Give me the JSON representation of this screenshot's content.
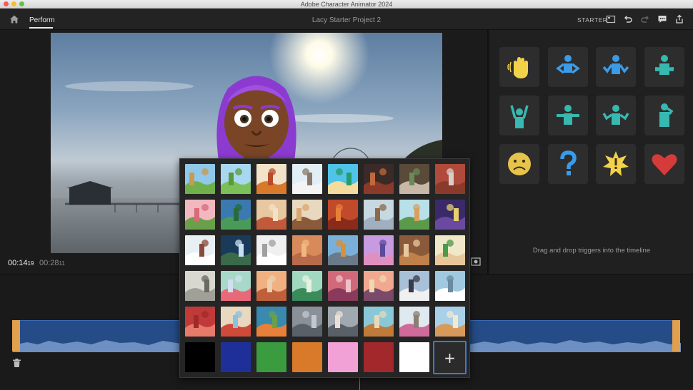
{
  "window": {
    "title": "Adobe Character Animator 2024"
  },
  "appbar": {
    "home_icon": "home-icon",
    "mode_tab": "Perform",
    "project_title": "Lacy Starter Project 2",
    "mode_badge": "STARTER",
    "icons": [
      "panel-toggle-icon",
      "undo-icon",
      "redo-icon",
      "comment-icon",
      "share-icon"
    ]
  },
  "stage": {
    "current_time": "00:14",
    "current_frame": "19",
    "total_time": "00:28",
    "total_frame": "11",
    "record_icon": "record-icon"
  },
  "triggers": {
    "hint": "Drag and drop triggers into the timeline",
    "tiles": [
      {
        "name": "wave",
        "color": "#f2d24b"
      },
      {
        "name": "hands-on-hips",
        "color": "#3a9be8"
      },
      {
        "name": "shrug-blue",
        "color": "#3a9be8"
      },
      {
        "name": "arms-crossed",
        "color": "#37b8b0"
      },
      {
        "name": "hands-up",
        "color": "#37b8b0"
      },
      {
        "name": "arms-out",
        "color": "#37b8b0"
      },
      {
        "name": "shrug-teal",
        "color": "#37b8b0"
      },
      {
        "name": "thinking",
        "color": "#37b8b0"
      },
      {
        "name": "sad-face",
        "color": "#e6c34a"
      },
      {
        "name": "question-mark",
        "color": "#3a9be8"
      },
      {
        "name": "exclamation-burst",
        "color": "#f2d24b"
      },
      {
        "name": "heart",
        "color": "#d63b3b"
      }
    ]
  },
  "background_picker": {
    "thumbnails": [
      [
        "forest",
        "meadow",
        "autumn-trees",
        "winter-birch",
        "tropical-beach",
        "city-night",
        "alley",
        "brick-wall"
      ],
      [
        "pink-hills",
        "green-valley",
        "interior-doorway",
        "living-room",
        "red-desert",
        "office",
        "green-road",
        "castle-night"
      ],
      [
        "snowy-cabin",
        "stadium-lights",
        "studio-white",
        "adobe-house",
        "boulder-lake",
        "purple-planet",
        "wooden-shack",
        "desert-cactus"
      ],
      [
        "sketch-town",
        "cherry-blossom",
        "canyon",
        "misty-hills",
        "pink-mountains",
        "sunset-tree",
        "lighthouse",
        "snowy-peaks"
      ],
      [
        "red-canyon",
        "playground",
        "orange-trees",
        "gray-columns",
        "ship-harbor",
        "treehouse",
        "garden-trellis",
        "farmhouse"
      ]
    ],
    "swatches": [
      "#000000",
      "#1f2f9a",
      "#3a9c3e",
      "#d97a2b",
      "#f2a1d6",
      "#a3282b",
      "#ffffff"
    ],
    "add_label": "+"
  },
  "timeline": {
    "delete_icon": "trash-icon"
  }
}
